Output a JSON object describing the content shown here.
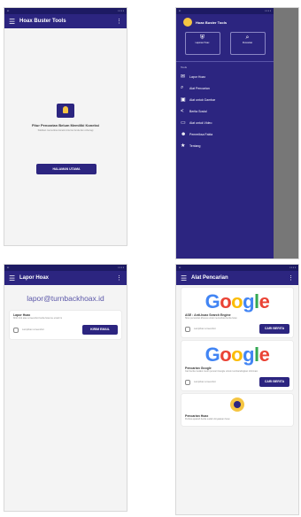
{
  "screen1": {
    "title": "Hoax Buster Tools",
    "empty_text": "Fitur Pencarian Belum Memiliki Koneksi",
    "empty_sub": "Silahkan memeriksa koneksi internet Anda dan coba lagi",
    "button": "HALAMAN UTAMA"
  },
  "screen2": {
    "title": "Hoax Buster Tools",
    "btn1": "Laporan Hoax",
    "btn2": "Pencarian",
    "section": "Tools",
    "items": [
      "Lapor Hoax",
      "Alat Pencarian",
      "Alat untuk Gambar",
      "Berita Sosial",
      "Alat untuk Video",
      "Pemeriksa Fakta",
      "Tentang"
    ]
  },
  "screen3": {
    "title": "Lapor Hoax",
    "email": "lapor@turnbackhoax.id",
    "label": "Lapor Hoax",
    "desc": "Kirim link atau screenshot berita hoax ke email ini",
    "check": "Lampirkan screenshot",
    "button": "KIRIM EMAIL"
  },
  "screen4": {
    "title": "Alat Pencarian",
    "card1_label": "ASE : Anti-hoax Search Engine",
    "card1_desc": "Situs pencarian khusus untuk memeriksa berita hoax",
    "card2_label": "Pencarian Google",
    "card2_desc": "Cari berita melalui mesin pencari Google untuk membandingkan informasi",
    "card3_label": "Pencarian Hoax",
    "card3_desc": "Periksa apakah berita sudah dinyatakan hoax",
    "check": "Lampirkan screenshot",
    "button": "CARI BERITA"
  },
  "colors": {
    "primary": "#2c2580",
    "statusbar": "#1d1a63"
  }
}
